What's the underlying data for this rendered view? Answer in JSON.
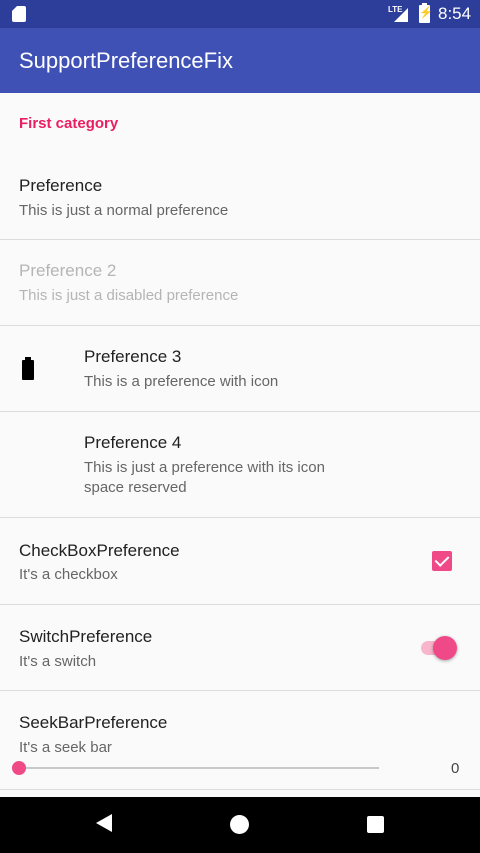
{
  "status_bar": {
    "network_type": "LTE",
    "time": "8:54",
    "icons": [
      "sd-card-icon",
      "signal-icon",
      "battery-charging-icon"
    ]
  },
  "app_bar": {
    "title": "SupportPreferenceFix"
  },
  "category": {
    "title": "First category",
    "color": "#e91e63"
  },
  "preferences": [
    {
      "title": "Preference",
      "summary": "This is just a normal preference"
    },
    {
      "title": "Preference 2",
      "summary": "This is just a disabled preference",
      "enabled": false
    },
    {
      "title": "Preference 3",
      "summary": "This is a preference with icon",
      "icon": "battery-icon"
    },
    {
      "title": "Preference 4",
      "summary": "This is just a preference with its icon space reserved"
    },
    {
      "title": "CheckBoxPreference",
      "summary": "It's a checkbox",
      "checked": true
    },
    {
      "title": "SwitchPreference",
      "summary": "It's a switch",
      "on": true
    },
    {
      "title": "SeekBarPreference",
      "summary": "It's a seek bar",
      "value": 0
    }
  ],
  "nav_bar": {
    "icons": [
      "back-icon",
      "home-icon",
      "recents-icon"
    ]
  },
  "colors": {
    "primary": "#3f51b5",
    "primary_dark": "#2c3e9a",
    "accent": "#ef4a87"
  }
}
